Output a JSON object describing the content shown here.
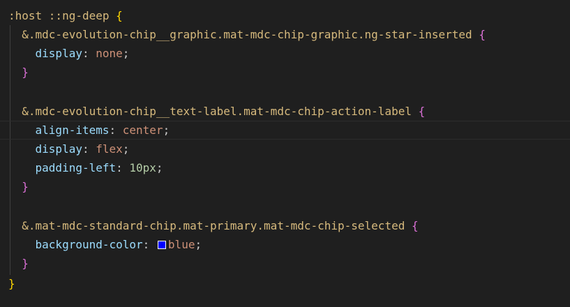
{
  "colors": {
    "background": "#1f1f1f",
    "selector": "#d7ba7d",
    "property": "#9cdcfe",
    "value": "#ce9178",
    "number": "#b5cea8",
    "brace_outer": "#ffd700",
    "brace_inner": "#da70d6",
    "swatch": "#0000ff"
  },
  "lines": [
    {
      "selector": ":host ::ng-deep",
      "open": "{"
    },
    {
      "selector": "&.mdc-evolution-chip__graphic.mat-mdc-chip-graphic.ng-star-inserted",
      "open": "{"
    },
    {
      "property": "display",
      "value": "none"
    },
    {
      "close": "}"
    },
    {},
    {
      "selector": "&.mdc-evolution-chip__text-label.mat-mdc-chip-action-label",
      "open": "{"
    },
    {
      "property": "align-items",
      "value": "center"
    },
    {
      "property": "display",
      "value": "flex"
    },
    {
      "property": "padding-left",
      "value": "10px"
    },
    {
      "close": "}"
    },
    {},
    {
      "selector": "&.mat-mdc-standard-chip.mat-primary.mat-mdc-chip-selected",
      "open": "{"
    },
    {
      "property": "background-color",
      "value": "blue"
    },
    {
      "close": "}"
    },
    {
      "close": "}"
    }
  ]
}
